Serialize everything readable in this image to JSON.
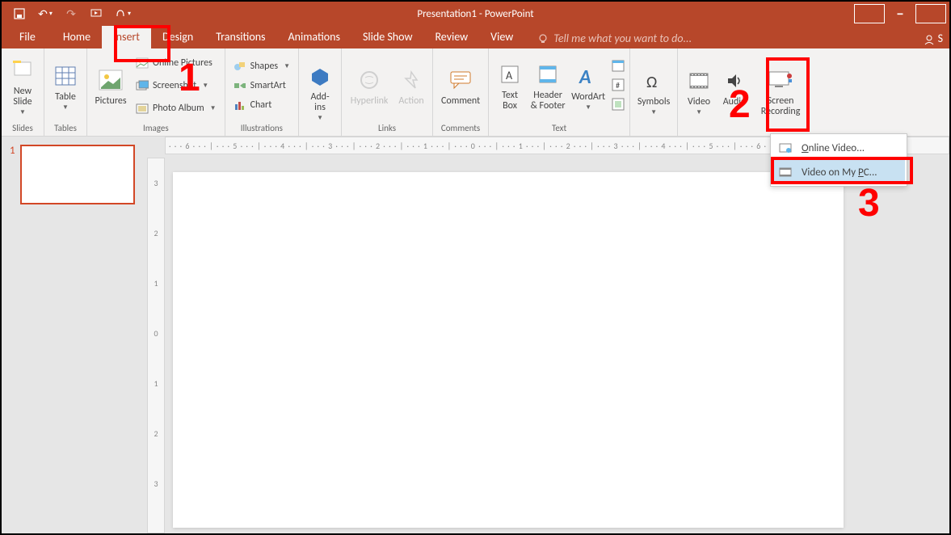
{
  "title": "Presentation1 - PowerPoint",
  "tabs": {
    "file": "File",
    "home": "Home",
    "insert": "Insert",
    "design": "Design",
    "transitions": "Transitions",
    "animations": "Animations",
    "slideshow": "Slide Show",
    "review": "Review",
    "view": "View",
    "tellme": "Tell me what you want to do..."
  },
  "ribbon": {
    "slides": {
      "new_slide": "New\nSlide",
      "label": "Slides"
    },
    "tables": {
      "table": "Table",
      "label": "Tables"
    },
    "images": {
      "pictures": "Pictures",
      "online_pictures": "Online Pictures",
      "screenshot": "Screenshot",
      "photo_album": "Photo Album",
      "label": "Images"
    },
    "illustrations": {
      "shapes": "Shapes",
      "smartart": "SmartArt",
      "chart": "Chart",
      "label": "Illustrations"
    },
    "addins": {
      "addins": "Add-\nins",
      "label": ""
    },
    "links": {
      "hyperlink": "Hyperlink",
      "action": "Action",
      "label": "Links"
    },
    "comments": {
      "comment": "Comment",
      "label": "Comments"
    },
    "text": {
      "text_box": "Text\nBox",
      "header_footer": "Header\n& Footer",
      "wordart": "WordArt",
      "label": "Text"
    },
    "symbols": {
      "symbols": "Symbols",
      "label": ""
    },
    "media": {
      "video": "Video",
      "audio": "Audio",
      "screen_recording": "Screen\nRecording",
      "label": ""
    }
  },
  "video_menu": {
    "online": "Online Video...",
    "on_pc": "Video on My PC..."
  },
  "thumb": {
    "number": "1"
  },
  "ruler": {
    "h": "· · · 6 · · · | · · · 5 · · · | · · · 4 · · · | · · · 3 · · · | · · · 2 · · · | · · · 1 · · · | · · · 0 · · · | · · · 1 · · · | · · · 2 · · · | · · · 3 · · · | · · · 4 · · · | · · · 5 · · · | · · · 6 · · ·",
    "v_ticks": [
      "3",
      "2",
      "1",
      "0",
      "1",
      "2",
      "3"
    ]
  },
  "annotations": {
    "one": "1",
    "two": "2",
    "three": "3"
  },
  "user_label": "S"
}
